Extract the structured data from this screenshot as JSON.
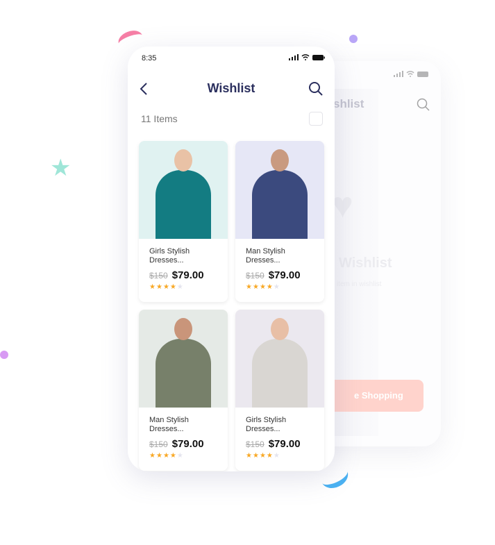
{
  "status_bar": {
    "time": "8:35"
  },
  "header": {
    "title": "Wishlist",
    "back_icon": "chevron-left-icon",
    "search_icon": "search-icon"
  },
  "list": {
    "count_label": "11 Items",
    "select_all_checked": false
  },
  "products": [
    {
      "name": "Girls Stylish Dresses...",
      "old_price": "$150",
      "price": "$79.00",
      "rating": 4,
      "bg": "#e0f2f1",
      "cloth": "#137c82",
      "skin": "#e9c2a6"
    },
    {
      "name": "Man Stylish Dresses...",
      "old_price": "$150",
      "price": "$79.00",
      "rating": 4,
      "bg": "#e6e7f6",
      "cloth": "#3b4a7e",
      "skin": "#c99a80"
    },
    {
      "name": "Man Stylish Dresses...",
      "old_price": "$150",
      "price": "$79.00",
      "rating": 4,
      "bg": "#e5eae6",
      "cloth": "#77806a",
      "skin": "#c9957a"
    },
    {
      "name": "Girls Stylish Dresses...",
      "old_price": "$150",
      "price": "$79.00",
      "rating": 4,
      "bg": "#ebe8ef",
      "cloth": "#d9d6d2",
      "skin": "#e8bfa6"
    }
  ],
  "back_screen": {
    "title_fragment": "shlist",
    "empty_title_fragment": "Wishlist",
    "empty_sub_fragment": "item in wishlist",
    "button_fragment": "e Shopping"
  },
  "colors": {
    "primary": "#2b2f5e",
    "star": "#f8a825",
    "button": "#ffd3cc"
  }
}
